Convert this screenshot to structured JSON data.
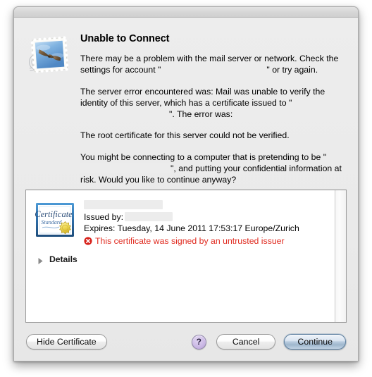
{
  "dialog": {
    "app_icon_name": "mail-stamp-icon",
    "title": "Unable to Connect",
    "paragraphs": {
      "p1_before": "There may be a problem with the mail server or network. Check the settings for account \"",
      "p1_after": "\" or try again.",
      "p2_before": "The server error encountered was: Mail was unable to verify the identity of this server, which has a certificate issued to \"",
      "p2_after": "\". The error was:",
      "p3": "The root certificate for this server could not be verified.",
      "p4_before": "You might be connecting to a computer that is pretending to be \"",
      "p4_after": "\", and putting your confidential information at risk. Would you like to continue anyway?"
    }
  },
  "certificate": {
    "badge_icon_name": "certificate-seal-icon",
    "badge_text_primary": "Certificate",
    "badge_text_secondary": "Standard",
    "subject_redacted": "",
    "issued_by_label": "Issued by:",
    "issued_by_redacted": "",
    "expires_line": "Expires: Tuesday, 14 June 2011 17:53:17 Europe/Zurich",
    "error_icon_name": "error-circle-x-icon",
    "error_text": "This certificate was signed by an untrusted issuer",
    "details_label": "Details",
    "details_expanded": false
  },
  "buttons": {
    "hide_certificate": "Hide Certificate",
    "help": "?",
    "cancel": "Cancel",
    "continue": "Continue"
  },
  "colors": {
    "error_red": "#e02b20",
    "default_button_blue": "#9fb7cd",
    "help_button_purple": "#b7a2d6",
    "dialog_background": "#ededed",
    "panel_background": "#ffffff",
    "redaction_gray": "#ececec"
  }
}
